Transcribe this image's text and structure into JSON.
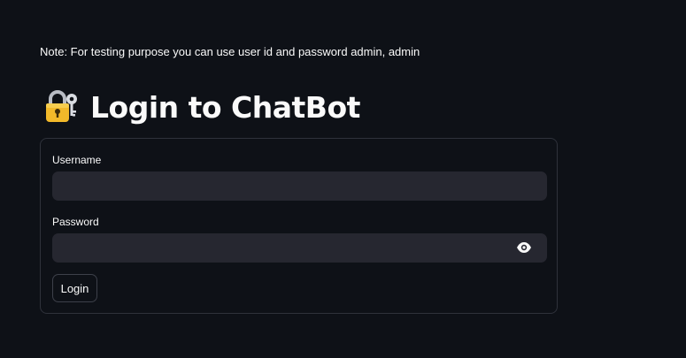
{
  "note": "Note: For testing purpose you can use user id and password admin, admin",
  "header": {
    "icon": "locked-with-key-icon",
    "title": "Login to ChatBot"
  },
  "form": {
    "username_label": "Username",
    "username_value": "",
    "password_label": "Password",
    "password_value": "",
    "password_toggle_icon": "eye-icon",
    "submit_label": "Login"
  },
  "colors": {
    "background": "#0e1117",
    "input_background": "#262730",
    "border": "#2f323b",
    "text": "#fafafa"
  }
}
